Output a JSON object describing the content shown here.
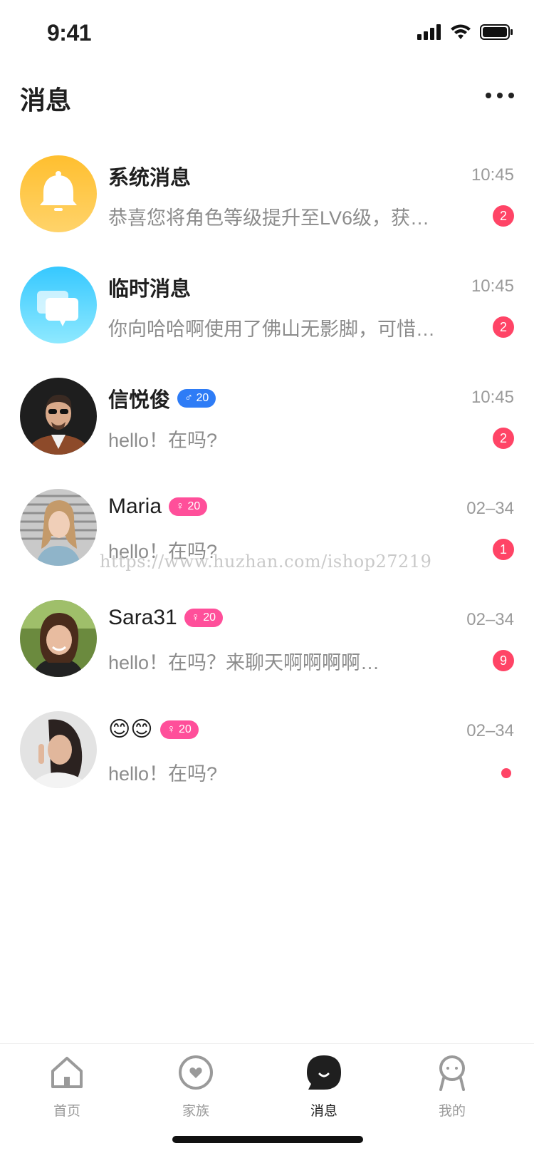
{
  "status": {
    "time": "9:41",
    "signal_icon": "signal-icon",
    "wifi_icon": "wifi-icon",
    "battery_icon": "battery-icon"
  },
  "header": {
    "title": "消息",
    "more_icon": "more-icon"
  },
  "messages": [
    {
      "name": "系统消息",
      "time": "10:45",
      "preview": "恭喜您将角色等级提升至LV6级，获…",
      "unread": "2",
      "avatar": "bell-icon"
    },
    {
      "name": "临时消息",
      "time": "10:45",
      "preview": "你向哈哈啊使用了佛山无影脚，可惜…",
      "unread": "2",
      "avatar": "chat-bubbles-icon"
    },
    {
      "name": "信悦俊",
      "badge": "♂ 20",
      "time": "10:45",
      "preview": "hello！在吗?",
      "unread": "2"
    },
    {
      "name": "Maria",
      "badge": "♀ 20",
      "time": "02–34",
      "preview": "hello！在吗?",
      "unread": "1"
    },
    {
      "name": "Sara31",
      "badge": "♀ 20",
      "time": "02–34",
      "preview": "hello！在吗？来聊天啊啊啊啊…",
      "unread": "9"
    },
    {
      "name": "😊😊",
      "badge": "♀ 20",
      "time": "02–34",
      "preview": "hello！在吗?",
      "unread_dot": true
    }
  ],
  "watermark": "https://www.huzhan.com/ishop27219",
  "tabbar": [
    {
      "label": "首页",
      "icon": "home-icon",
      "active": false
    },
    {
      "label": "家族",
      "icon": "heart-circle-icon",
      "active": false
    },
    {
      "label": "消息",
      "icon": "message-icon",
      "active": true
    },
    {
      "label": "我的",
      "icon": "profile-icon",
      "active": false
    }
  ],
  "colors": {
    "unread": "#ff4466",
    "male_badge": "#2e7cf6",
    "female_badge": "#ff4f9a",
    "system_avatar": "#ffc43d",
    "temp_avatar": "#3fd2ff"
  }
}
